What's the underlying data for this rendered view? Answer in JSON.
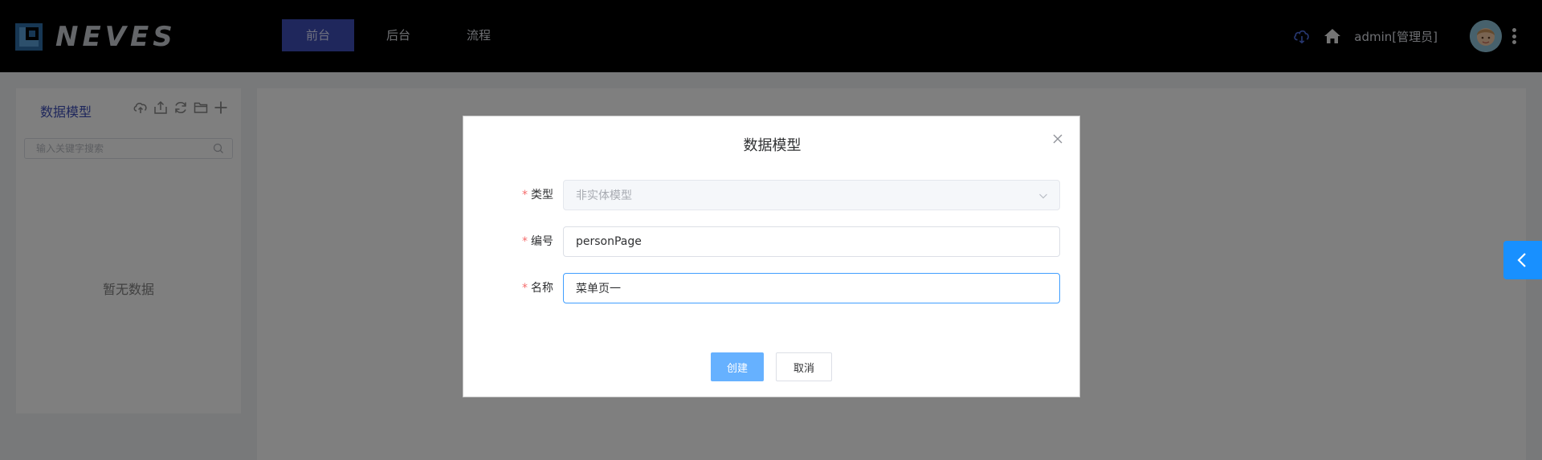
{
  "header": {
    "brand": "NEVES",
    "nav": [
      {
        "label": "前台",
        "active": true
      },
      {
        "label": "后台",
        "active": false
      },
      {
        "label": "流程",
        "active": false
      }
    ],
    "user": "admin[管理员]",
    "accent_color": "#3e4fb8"
  },
  "sidebar": {
    "title": "数据模型",
    "toolbar_icons": [
      "cloud-upload-icon",
      "export-icon",
      "refresh-icon",
      "folder-icon",
      "add-icon"
    ],
    "search_placeholder": "输入关键字搜索",
    "empty_text": "暂无数据"
  },
  "dialog": {
    "title": "数据模型",
    "fields": {
      "type": {
        "label": "类型",
        "required_mark": "*",
        "value": "非实体模型",
        "disabled": true
      },
      "code": {
        "label": "编号",
        "required_mark": "*",
        "value": "personPage"
      },
      "name": {
        "label": "名称",
        "required_mark": "*",
        "value": "菜单页一"
      }
    },
    "create_label": "创建",
    "cancel_label": "取消"
  }
}
